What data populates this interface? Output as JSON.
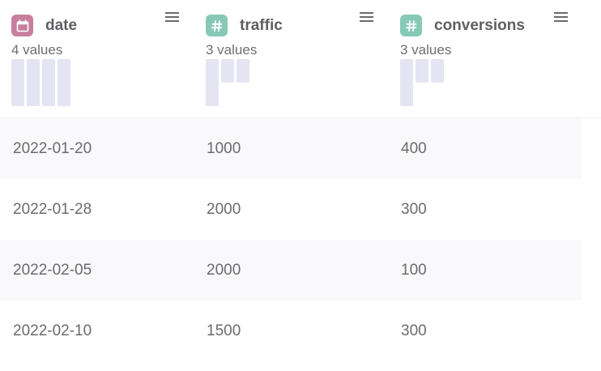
{
  "columns": [
    {
      "name": "date",
      "type_icon": "calendar-icon",
      "badge_color": "#c77f9d",
      "values_summary": "4 values",
      "histogram": [
        1,
        1,
        1,
        1
      ]
    },
    {
      "name": "traffic",
      "type_icon": "hash-icon",
      "badge_color": "#86c9b6",
      "values_summary": "3 values",
      "histogram": [
        1,
        0.5,
        0.5
      ]
    },
    {
      "name": "conversions",
      "type_icon": "hash-icon",
      "badge_color": "#86c9b6",
      "values_summary": "3 values",
      "histogram": [
        1,
        0.5,
        0.5
      ]
    }
  ],
  "rows": [
    [
      "2022-01-20",
      "1000",
      "400"
    ],
    [
      "2022-01-28",
      "2000",
      "300"
    ],
    [
      "2022-02-05",
      "2000",
      "100"
    ],
    [
      "2022-02-10",
      "1500",
      "300"
    ]
  ],
  "colors": {
    "histogram_bar": "#e4e4f3",
    "row_stripe": "#f9f9fb"
  }
}
